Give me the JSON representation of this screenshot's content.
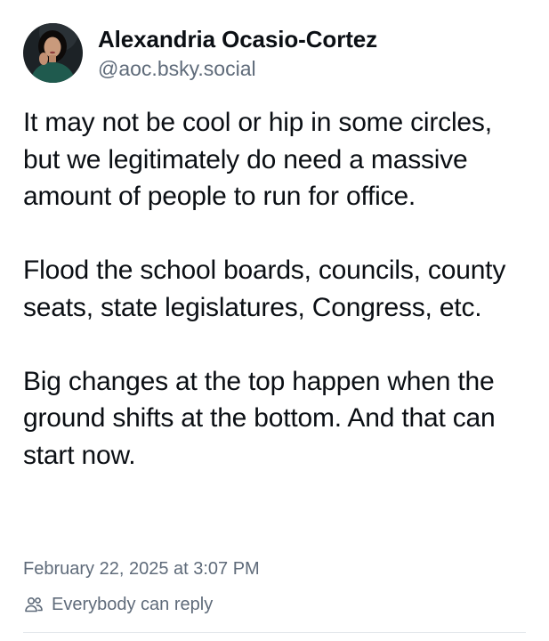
{
  "author": {
    "display_name": "Alexandria Ocasio-Cortez",
    "handle": "@aoc.bsky.social",
    "avatar_icon": "profile-photo"
  },
  "post": {
    "paragraphs": [
      "It may not be cool or hip in some circles, but we legitimately do need a massive amount of people to run for office.",
      "Flood the school boards, councils, county seats, state legislatures, Congress, etc.",
      "Big changes at the top happen when the ground shifts at the bottom. And that can start now."
    ],
    "timestamp": "February 22, 2025 at 3:07 PM",
    "reply_setting": "Everybody can reply",
    "reply_icon": "people-icon"
  },
  "colors": {
    "text_primary": "#0b0f14",
    "text_secondary": "#5f6b7a",
    "divider": "#e3e7eb",
    "background": "#ffffff"
  }
}
